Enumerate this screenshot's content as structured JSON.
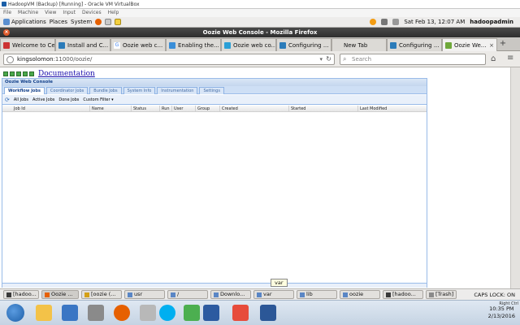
{
  "vbox": {
    "title": "HadoopVM (Backup) [Running] - Oracle VM VirtualBox",
    "menu": [
      "File",
      "Machine",
      "View",
      "Input",
      "Devices",
      "Help"
    ]
  },
  "gnome_panel": {
    "applications": "Applications",
    "places": "Places",
    "system": "System",
    "datetime": "Sat Feb 13, 12:07 AM",
    "user": "hadoopadmin"
  },
  "firefox": {
    "window_title": "Oozie Web Console - Mozilla Firefox",
    "tabs": [
      {
        "label": "Welcome to Ce...",
        "icon_color": "#cc3333"
      },
      {
        "label": "Install and C...",
        "icon_color": "#2b7bb9"
      },
      {
        "label": "Oozie web c...",
        "icon_color": "#4285f4",
        "icon_glyph": "G"
      },
      {
        "label": "Enabling the...",
        "icon_color": "#3a8ed8"
      },
      {
        "label": "Oozie web co...",
        "icon_color": "#2a9fd6"
      },
      {
        "label": "Configuring ...",
        "icon_color": "#2b7bb9"
      },
      {
        "label": "New Tab",
        "icon_color": "#dcdad6"
      },
      {
        "label": "Configuring ...",
        "icon_color": "#2b7bb9"
      },
      {
        "label": "Oozie We...",
        "icon_color": "#6fa83a",
        "active": true
      }
    ],
    "url_host": "kingsolomon",
    "url_rest": ":11000/oozie/",
    "search_placeholder": "Search"
  },
  "oozie": {
    "doc_link": "Documentation",
    "panel_title": "Oozie Web Console",
    "tabs": [
      "Workflow Jobs",
      "Coordinator Jobs",
      "Bundle Jobs",
      "System Info",
      "Instrumentation",
      "Settings"
    ],
    "toolbar": {
      "all_jobs": "All Jobs",
      "active_jobs": "Active Jobs",
      "done_jobs": "Done Jobs",
      "custom_filter": "Custom Filter ▾"
    },
    "columns": [
      "Job Id",
      "Name",
      "Status",
      "Run",
      "User",
      "Group",
      "Created",
      "Started",
      "Last Modified"
    ]
  },
  "bottom_panel": {
    "tooltip": "var",
    "caps": "CAPS LOCK: ON",
    "buttons": [
      {
        "label": "[hadoo...",
        "icon_color": "#3a3a3a"
      },
      {
        "label": "Oozie ...",
        "icon_color": "#e66000",
        "active": true
      },
      {
        "label": "[oozie (...",
        "icon_color": "#d4a017"
      },
      {
        "label": "usr",
        "icon_color": "#5a86c5"
      },
      {
        "label": "/",
        "icon_color": "#5a86c5"
      },
      {
        "label": "Downlo...",
        "icon_color": "#5a86c5"
      },
      {
        "label": "var",
        "icon_color": "#5a86c5"
      },
      {
        "label": "lib",
        "icon_color": "#5a86c5"
      },
      {
        "label": "oozie",
        "icon_color": "#5a86c5"
      },
      {
        "label": "[hadoo...",
        "icon_color": "#3a3a3a"
      },
      {
        "label": "[Trash]",
        "icon_color": "#8a8a8a"
      }
    ]
  },
  "windows": {
    "time": "10:35 PM",
    "date": "2/13/2016",
    "right_ctrl": "Right Ctrl"
  }
}
